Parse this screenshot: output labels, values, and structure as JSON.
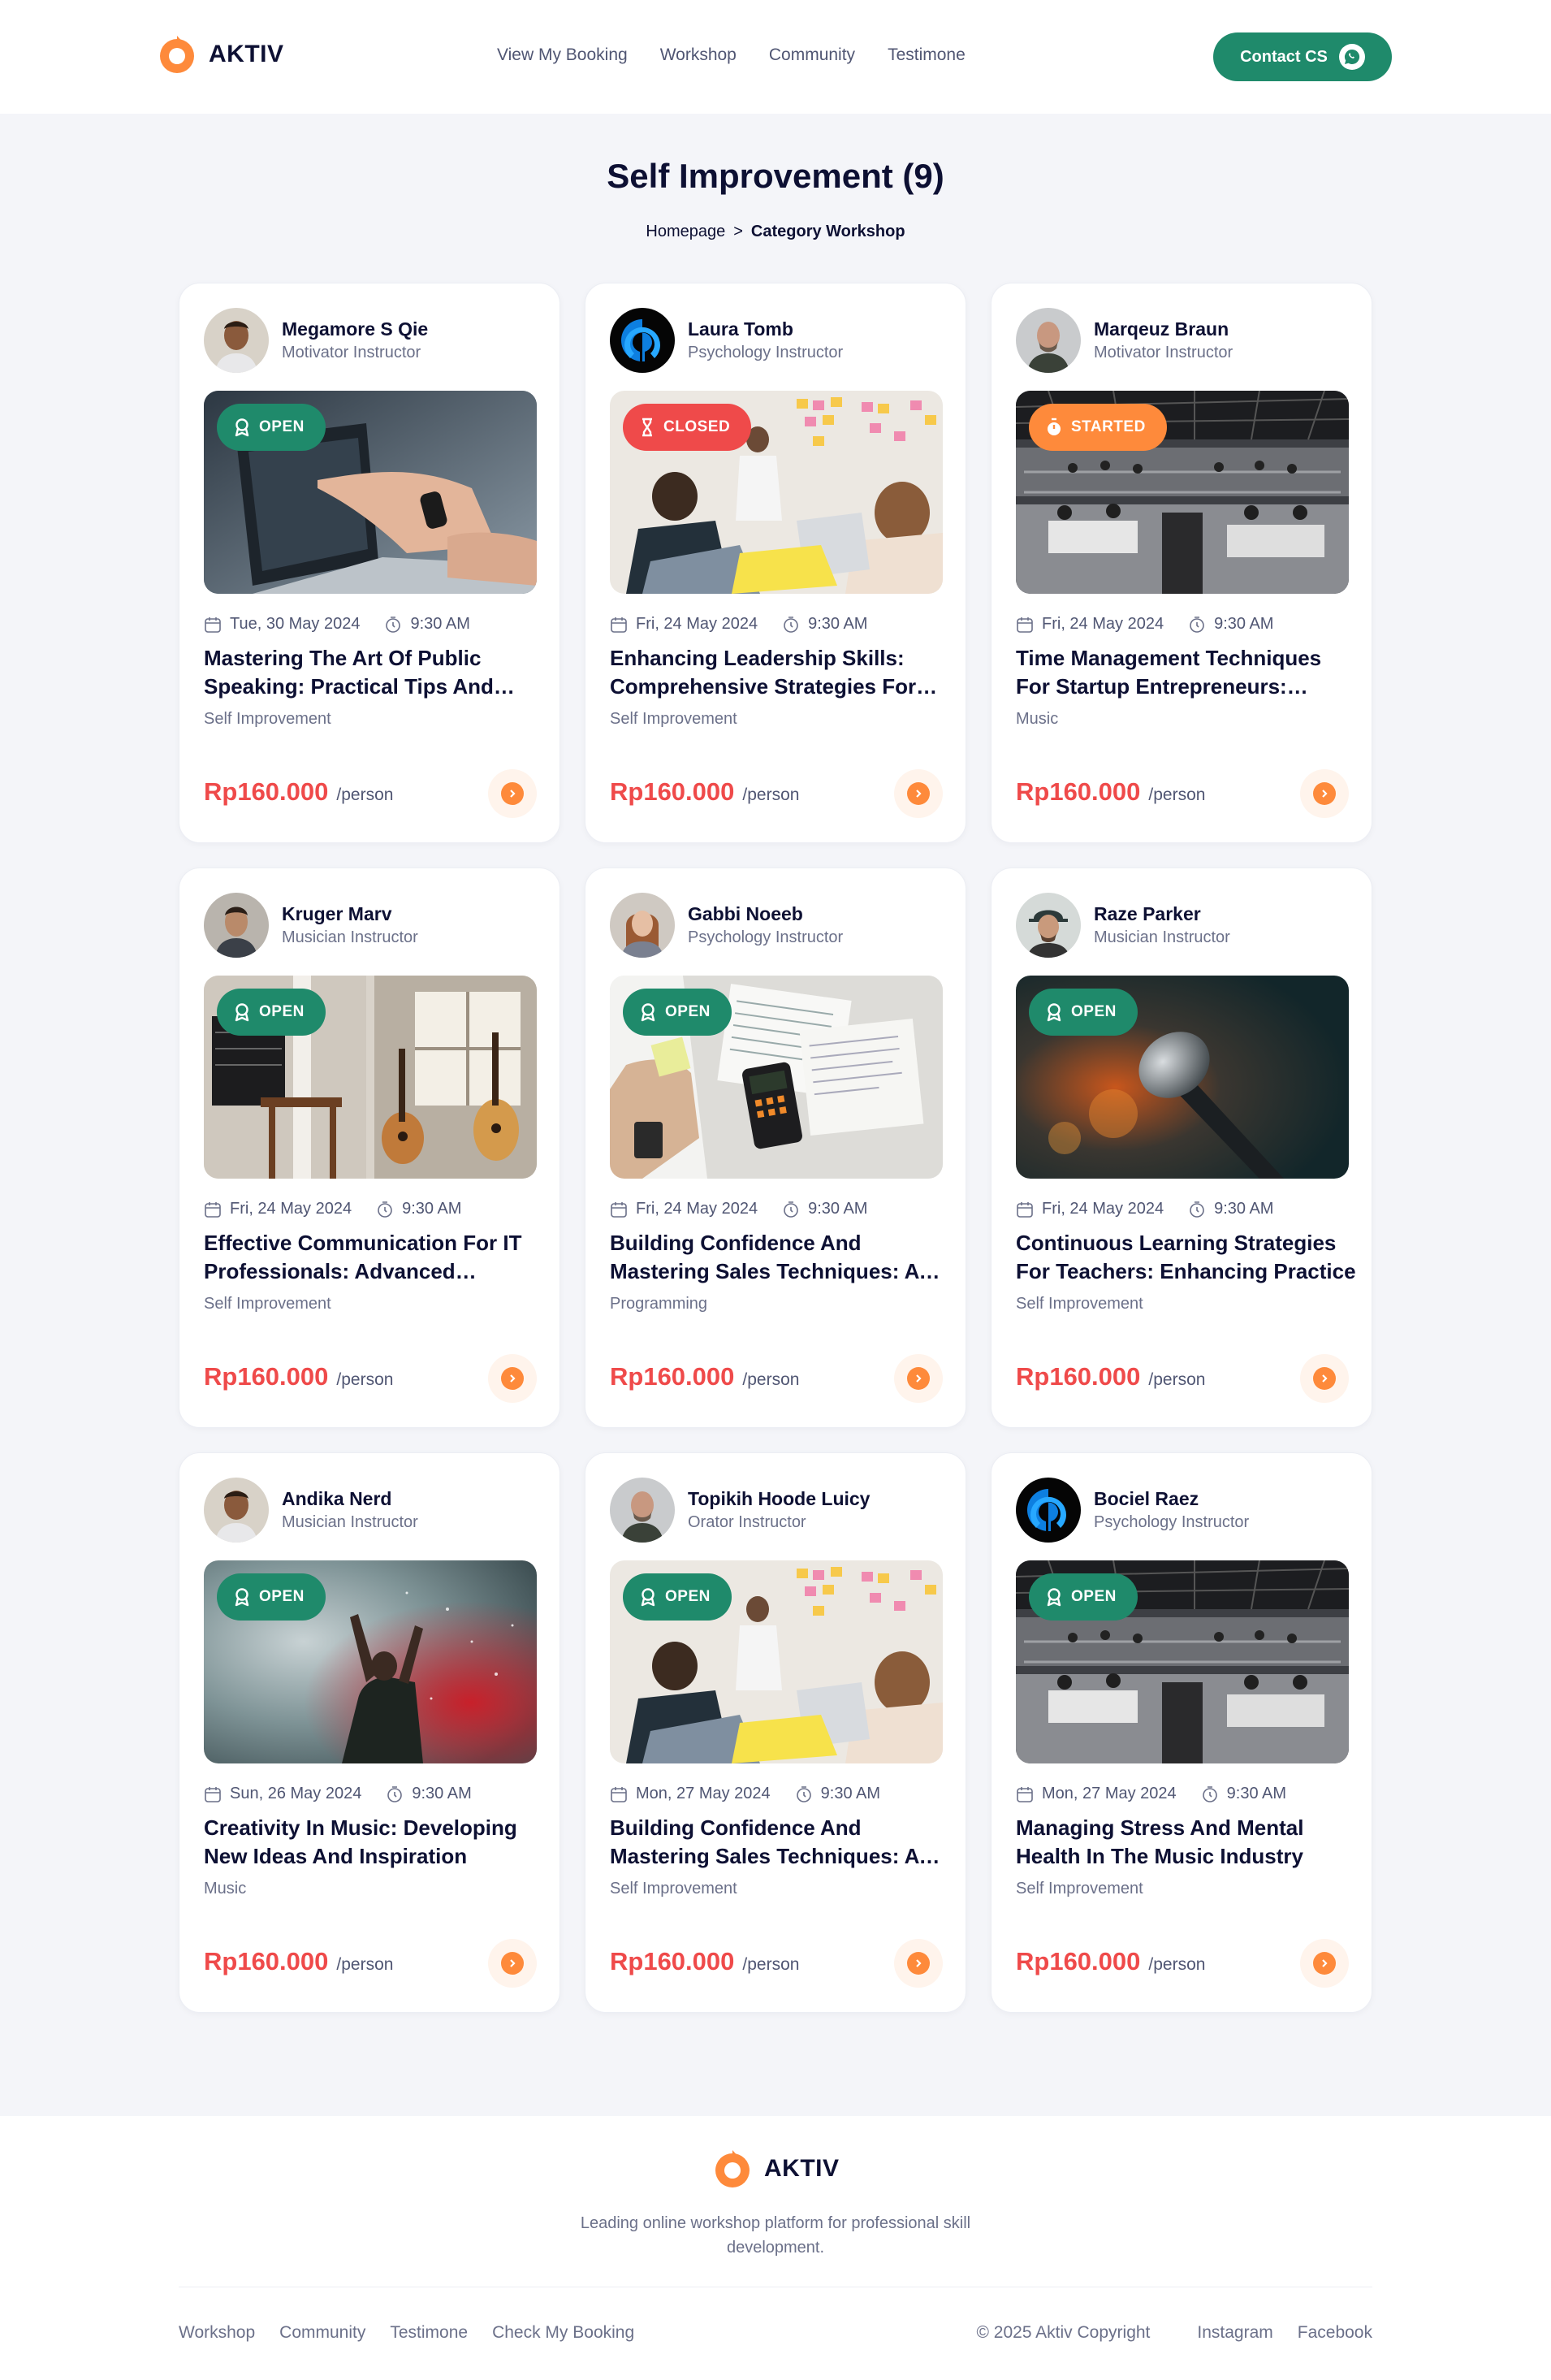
{
  "brand": {
    "name": "AKTIV"
  },
  "nav": {
    "items": [
      "View My Booking",
      "Workshop",
      "Community",
      "Testimone"
    ],
    "contact_label": "Contact CS"
  },
  "page": {
    "title": "Self Improvement (9)",
    "breadcrumb": {
      "home": "Homepage",
      "separator": ">",
      "current": "Category Workshop"
    }
  },
  "cards": [
    {
      "instructor": "Megamore S Qie",
      "role": "Motivator Instructor",
      "status": "OPEN",
      "date": "Tue, 30 May 2024",
      "time": "9:30 AM",
      "title": "Mastering The Art Of Public Speaking: Practical Tips And Techniques",
      "category": "Self Improvement",
      "price": "Rp160.000",
      "unit": "/person"
    },
    {
      "instructor": "Laura Tomb",
      "role": "Psychology Instructor",
      "status": "CLOSED",
      "date": "Fri, 24 May 2024",
      "time": "9:30 AM",
      "title": "Enhancing Leadership Skills: Comprehensive Strategies For Managers",
      "category": "Self Improvement",
      "price": "Rp160.000",
      "unit": "/person"
    },
    {
      "instructor": "Marqeuz Braun",
      "role": "Motivator Instructor",
      "status": "STARTED",
      "date": "Fri, 24 May 2024",
      "time": "9:30 AM",
      "title": "Time Management Techniques For Startup Entrepreneurs: Maximizing",
      "category": "Music",
      "price": "Rp160.000",
      "unit": "/person"
    },
    {
      "instructor": "Kruger Marv",
      "role": "Musician Instructor",
      "status": "OPEN",
      "date": "Fri, 24 May 2024",
      "time": "9:30 AM",
      "title": "Effective Communication For IT Professionals: Advanced Techniques",
      "category": "Self Improvement",
      "price": "Rp160.000",
      "unit": "/person"
    },
    {
      "instructor": "Gabbi Noeeb",
      "role": "Psychology Instructor",
      "status": "OPEN",
      "date": "Fri, 24 May 2024",
      "time": "9:30 AM",
      "title": "Building Confidence And Mastering Sales Techniques: A Complete Guide",
      "category": "Programming",
      "price": "Rp160.000",
      "unit": "/person"
    },
    {
      "instructor": "Raze Parker",
      "role": "Musician Instructor",
      "status": "OPEN",
      "date": "Fri, 24 May 2024",
      "time": "9:30 AM",
      "title": "Continuous Learning Strategies For Teachers: Enhancing Practice",
      "category": "Self Improvement",
      "price": "Rp160.000",
      "unit": "/person"
    },
    {
      "instructor": "Andika Nerd",
      "role": "Musician Instructor",
      "status": "OPEN",
      "date": "Sun, 26 May 2024",
      "time": "9:30 AM",
      "title": "Creativity In Music: Developing New Ideas And Inspiration",
      "category": "Music",
      "price": "Rp160.000",
      "unit": "/person"
    },
    {
      "instructor": "Topikih Hoode Luicy",
      "role": "Orator Instructor",
      "status": "OPEN",
      "date": "Mon, 27 May 2024",
      "time": "9:30 AM",
      "title": "Building Confidence And Mastering Sales Techniques: A Complete Guide",
      "category": "Self Improvement",
      "price": "Rp160.000",
      "unit": "/person"
    },
    {
      "instructor": "Bociel Raez",
      "role": "Psychology Instructor",
      "status": "OPEN",
      "date": "Mon, 27 May 2024",
      "time": "9:30 AM",
      "title": "Managing Stress And Mental Health In The Music Industry",
      "category": "Self Improvement",
      "price": "Rp160.000",
      "unit": "/person"
    }
  ],
  "footer": {
    "tagline": "Leading online workshop platform for professional skill development.",
    "links": [
      "Workshop",
      "Community",
      "Testimone",
      "Check My Booking"
    ],
    "copyright": "© 2025 Aktiv Copyright",
    "social": [
      "Instagram",
      "Facebook"
    ]
  },
  "colors": {
    "brand_orange": "#fe8a3b",
    "brand_green": "#1f8a6b",
    "price_red": "#ef4a4a",
    "navy": "#0d1033"
  }
}
